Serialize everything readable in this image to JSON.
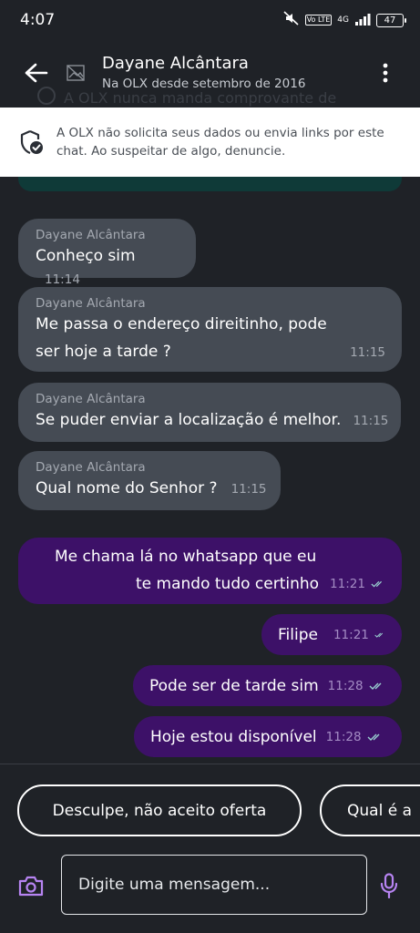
{
  "status_bar": {
    "time": "4:07",
    "volte": "Vo LTE",
    "network": "4G",
    "battery": "47"
  },
  "header": {
    "name": "Dayane Alcântara",
    "subtitle": "Na OLX desde setembro de 2016"
  },
  "ghost_text": "A OLX nunca manda comprovante de",
  "warning": {
    "text": "A OLX não solicita seus dados ou envia links por este chat. Ao suspeitar de algo, denuncie."
  },
  "messages": [
    {
      "sender": "Dayane Alcântara",
      "text": "Conheço sim",
      "time": "11:14"
    },
    {
      "sender": "Dayane Alcântara",
      "line1": "Me passa o endereço direitinho, pode",
      "line2": "ser hoje a tarde ?",
      "time": "11:15"
    },
    {
      "sender": "Dayane Alcântara",
      "text": "Se puder enviar a localização é melhor.",
      "time": "11:15"
    },
    {
      "sender": "Dayane Alcântara",
      "text": "Qual nome do Senhor ?",
      "time": "11:15"
    },
    {
      "line1": "Me chama lá no whatsapp que eu",
      "line2": "te mando tudo certinho",
      "time": "11:21"
    },
    {
      "text": "Filipe",
      "time": "11:21"
    },
    {
      "text": "Pode ser de tarde sim",
      "time": "11:28"
    },
    {
      "text": "Hoje estou disponível",
      "time": "11:28"
    }
  ],
  "quick_replies": [
    "Desculpe, não aceito oferta",
    "Qual é a"
  ],
  "composer": {
    "placeholder": "Digite uma mensagem..."
  },
  "colors": {
    "background": "#1f2227",
    "incoming_bubble": "#454b54",
    "outgoing_bubble": "#3d1168",
    "accent": "#8a4fe0"
  }
}
